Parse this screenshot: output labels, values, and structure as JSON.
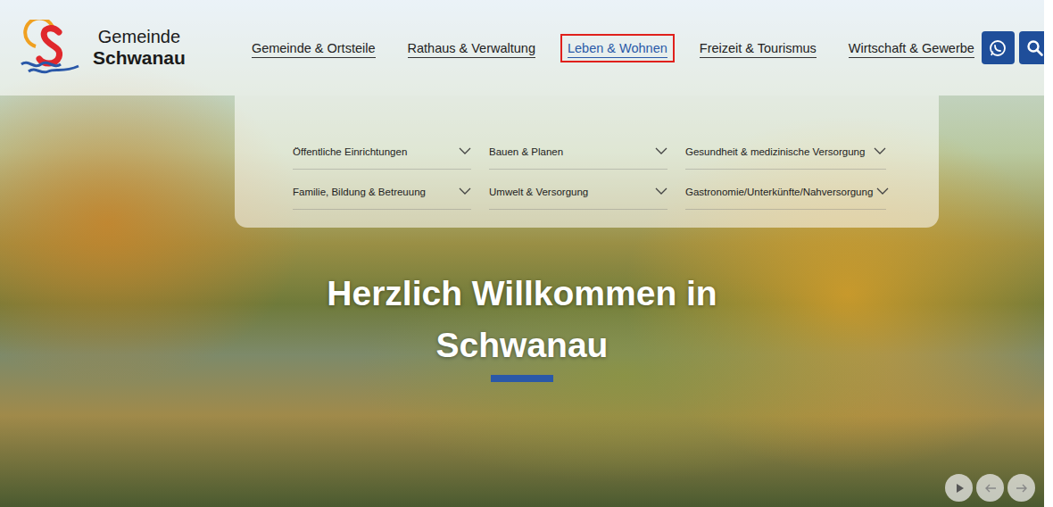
{
  "logo": {
    "line1": "Gemeinde",
    "line2": "Schwanau"
  },
  "nav": [
    {
      "label": "Gemeinde & Ortsteile",
      "selected": false
    },
    {
      "label": "Rathaus & Verwaltung",
      "selected": false
    },
    {
      "label": "Leben & Wohnen",
      "selected": true
    },
    {
      "label": "Freizeit & Tourismus",
      "selected": false
    },
    {
      "label": "Wirtschaft & Gewerbe",
      "selected": false
    }
  ],
  "menu": [
    {
      "label": "Öffentliche Einrichtungen",
      "expanded": false
    },
    {
      "label": "Bauen & Planen",
      "expanded": false
    },
    {
      "label": "Gesundheit & medizinische Versorgung",
      "expanded": false
    },
    {
      "label": "Familie, Bildung & Betreuung",
      "expanded": false
    },
    {
      "label": "Umwelt & Versorgung",
      "expanded": false
    },
    {
      "label": "Gastronomie/Unterkünfte/Nahversorgung",
      "expanded": false
    }
  ],
  "hero": {
    "title": "Herzlich Willkommen in Schwanau"
  }
}
